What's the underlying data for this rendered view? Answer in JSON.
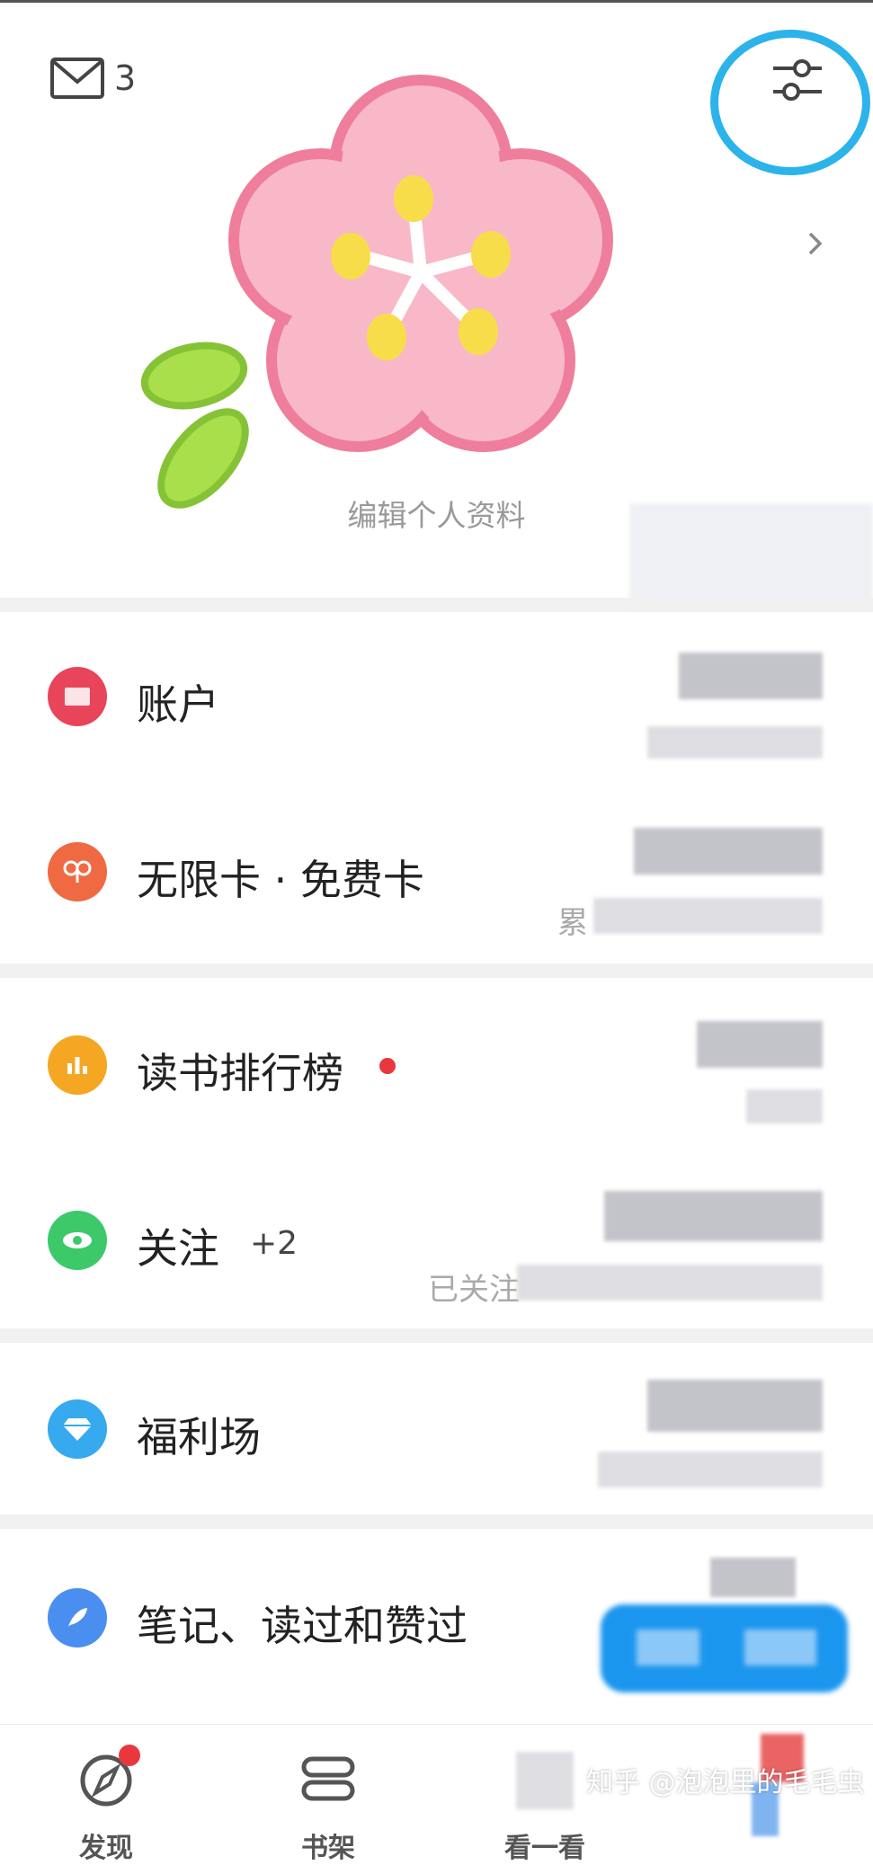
{
  "header": {
    "mail_count": "3",
    "edit_profile": "编辑个人资料"
  },
  "menu": {
    "account": "账户",
    "card": "无限卡 · 免费卡",
    "card_sub_prefix": "累",
    "ranking": "读书排行榜",
    "follow": "关注",
    "follow_extra": "+2",
    "follow_sub_prefix": "已关注",
    "welfare": "福利场",
    "notes": "笔记、读过和赞过"
  },
  "nav": {
    "discover": "发现",
    "shelf": "书架",
    "look": "看一看"
  },
  "watermark": "知乎 @泡泡里的毛毛虫",
  "colors": {
    "highlight": "#2bb3ea",
    "account": "#e8445a",
    "card": "#ef6a42",
    "ranking": "#f5a623",
    "follow": "#3dc96a",
    "welfare": "#36a9ef",
    "notes": "#4a8ff0",
    "red_dot": "#e8383d"
  }
}
